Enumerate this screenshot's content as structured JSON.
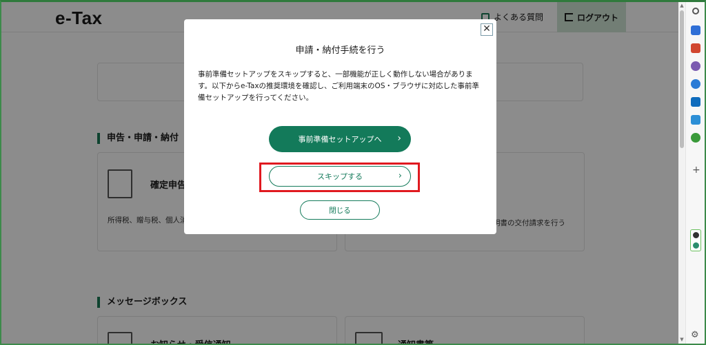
{
  "header": {
    "logo": "e-Tax",
    "faq_label": "よくある質問",
    "logout_label": "ログアウト"
  },
  "sections": [
    {
      "title": "申告・申請・納付",
      "cards": [
        {
          "title": "確定申告",
          "desc": "所得税、贈与税、個人消"
        },
        {
          "title": "",
          "desc": "明書の交付請求を行う"
        }
      ]
    },
    {
      "title": "メッセージボックス",
      "cards": [
        {
          "title": "お知らせ・受信通知"
        },
        {
          "title": "通知書等"
        }
      ]
    }
  ],
  "modal": {
    "close_symbol": "✕",
    "title": "申請・納付手続を行う",
    "body": "事前準備セットアップをスキップすると、一部機能が正しく動作しない場合があります。以下からe-Taxの推奨環境を確認し、ご利用端末のOS・ブラウザに対応した事前準備セットアップを行ってください。",
    "primary_button": "事前準備セットアップへ",
    "skip_button": "スキップする",
    "close_button": "閉じる",
    "chevron": "›"
  },
  "sidepanel": {
    "icons": [
      "search-icon",
      "tag-icon",
      "briefcase-icon",
      "people-icon",
      "copilot-icon",
      "outlook-icon",
      "shopping-icon",
      "tree-icon",
      "add-icon",
      "settings-icon"
    ],
    "colors": {
      "search": "#555555",
      "tag": "#2f6fd6",
      "briefcase": "#d1462f",
      "people": "#7b5bb0",
      "copilot": "#2b7bd6",
      "outlook": "#0f6cbd",
      "shopping": "#2c8fd6",
      "tree": "#3a9a3a"
    }
  },
  "colors": {
    "brand_green": "#137a5a",
    "highlight_red": "#e0191f"
  }
}
